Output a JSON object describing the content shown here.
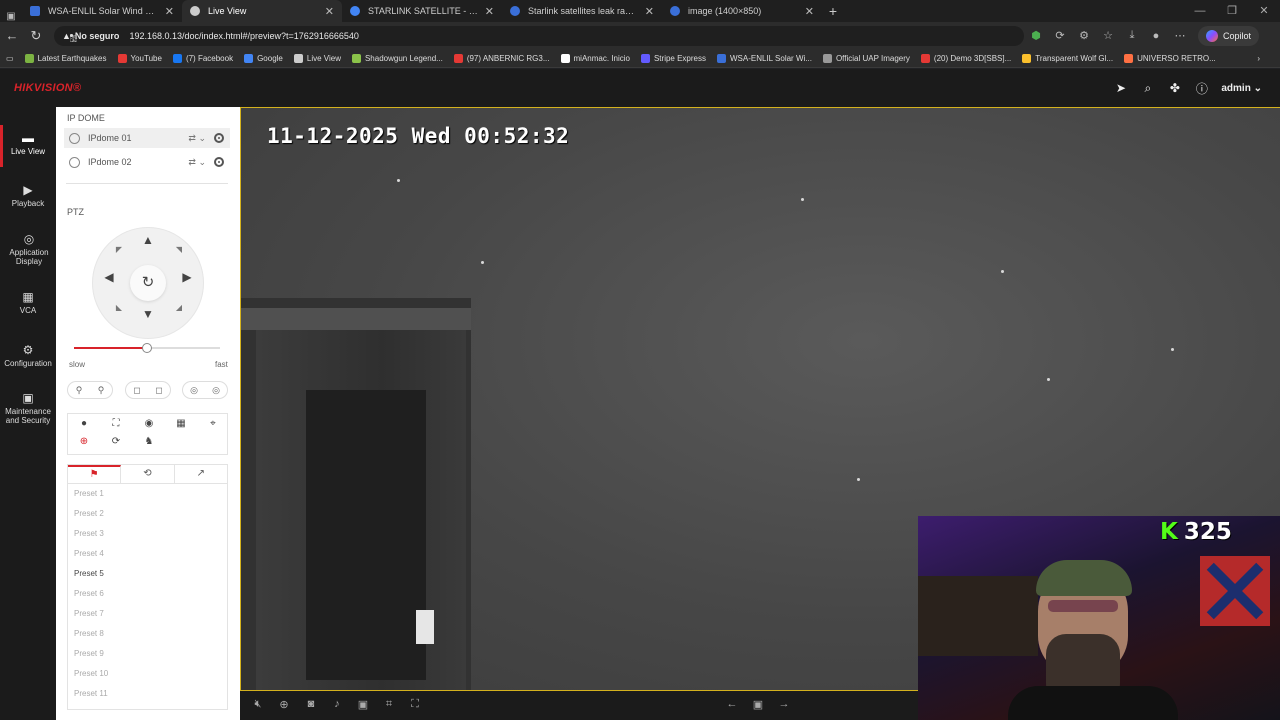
{
  "browser": {
    "tabs": [
      {
        "title": "WSA-ENLIL Solar Wind Prediction",
        "active": false,
        "favcolor": "#3a6fd8"
      },
      {
        "title": "Live View",
        "active": true,
        "favcolor": "#cccccc"
      },
      {
        "title": "STARLINK SATELLITE - Google Se...",
        "active": false,
        "favcolor": "#4285f4"
      },
      {
        "title": "Starlink satellites leak radio signal",
        "active": false,
        "favcolor": "#3a6fd8"
      },
      {
        "title": "image (1400×850)",
        "active": false,
        "favcolor": "#3a6fd8"
      }
    ],
    "security_label": "No seguro",
    "url": "192.168.0.13/doc/index.html#/preview?t=1762916666540",
    "copilot_label": "Copilot",
    "bookmarks": [
      {
        "label": "Latest Earthquakes",
        "color": "#7cb342"
      },
      {
        "label": "YouTube",
        "color": "#e53935"
      },
      {
        "label": "(7) Facebook",
        "color": "#1877f2"
      },
      {
        "label": "Google",
        "color": "#4285f4"
      },
      {
        "label": "Live View",
        "color": "#cccccc"
      },
      {
        "label": "Shadowgun Legend...",
        "color": "#8bc34a"
      },
      {
        "label": "(97) ANBERNIC RG3...",
        "color": "#e53935"
      },
      {
        "label": "miAnmac. Inicio",
        "color": "#ffffff"
      },
      {
        "label": "Stripe Express",
        "color": "#635bff"
      },
      {
        "label": "WSA-ENLIL Solar Wi...",
        "color": "#3a6fd8"
      },
      {
        "label": "Official UAP Imagery",
        "color": "#999999"
      },
      {
        "label": "(20) Demo 3D[SBS]...",
        "color": "#e53935"
      },
      {
        "label": "Transparent Wolf Gl...",
        "color": "#fbc02d"
      },
      {
        "label": "UNIVERSO RETRO...",
        "color": "#ff7043"
      }
    ]
  },
  "app": {
    "logo": "HIKVISION®",
    "user": "admin",
    "accent": "#d8232a"
  },
  "nav": [
    {
      "label": "Live View",
      "icon": "monitor-icon",
      "active": true
    },
    {
      "label": "Playback",
      "icon": "playback-icon",
      "active": false
    },
    {
      "label": "Application Display",
      "icon": "app-display-icon",
      "active": false
    },
    {
      "label": "VCA",
      "icon": "vca-icon",
      "active": false
    },
    {
      "label": "Configuration",
      "icon": "gear-icon",
      "active": false
    },
    {
      "label": "Maintenance and Security",
      "icon": "maintenance-icon",
      "active": false
    }
  ],
  "panel": {
    "device_group": "IP DOME",
    "devices": [
      "IPdome 01",
      "IPdome 02"
    ],
    "ptz_title": "PTZ",
    "speed_slow": "slow",
    "speed_fast": "fast",
    "speed_value": 0.5,
    "presets": [
      "Preset 1",
      "Preset 2",
      "Preset 3",
      "Preset 4",
      "Preset 5",
      "Preset 6",
      "Preset 7",
      "Preset 8",
      "Preset 9",
      "Preset 10",
      "Preset 11"
    ],
    "preset_active_index": 4
  },
  "video": {
    "osd_timestamp": "11-12-2025 Wed 00:52:32"
  },
  "overlay": {
    "kick_count": "325"
  }
}
